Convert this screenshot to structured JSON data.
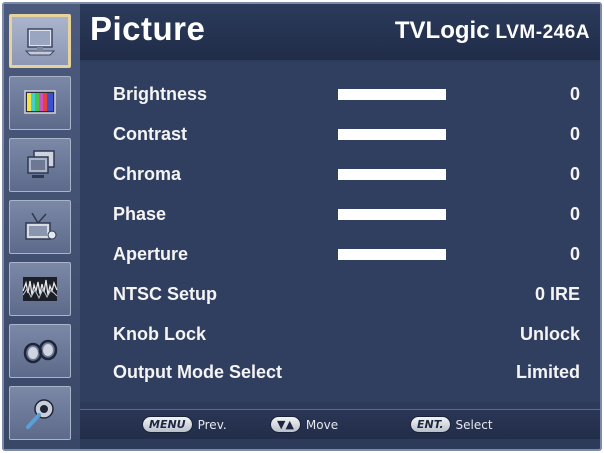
{
  "header": {
    "title": "Picture",
    "brand": "TVLogic",
    "model": "LVM-246A"
  },
  "sidebar": {
    "items": [
      {
        "icon": "monitor-icon",
        "active": true
      },
      {
        "icon": "color-bars-icon",
        "active": false
      },
      {
        "icon": "screens-icon",
        "active": false
      },
      {
        "icon": "satellite-dish-icon",
        "active": false
      },
      {
        "icon": "waveform-icon",
        "active": false
      },
      {
        "icon": "audio-icon",
        "active": false
      },
      {
        "icon": "tools-icon",
        "active": false
      }
    ]
  },
  "menu": {
    "items": [
      {
        "label": "Brightness",
        "value": "0",
        "bar": true
      },
      {
        "label": "Contrast",
        "value": "0",
        "bar": true
      },
      {
        "label": "Chroma",
        "value": "0",
        "bar": true
      },
      {
        "label": "Phase",
        "value": "0",
        "bar": true
      },
      {
        "label": "Aperture",
        "value": "0",
        "bar": true
      },
      {
        "label": "NTSC Setup",
        "value": "0 IRE",
        "bar": false
      },
      {
        "label": "Knob Lock",
        "value": "Unlock",
        "bar": false
      },
      {
        "label": "Output Mode Select",
        "value": "Limited",
        "bar": false
      }
    ]
  },
  "footer": {
    "hints": [
      {
        "key": "MENU",
        "text": "Prev."
      },
      {
        "key": "▼▲",
        "text": "Move"
      },
      {
        "key": "ENT.",
        "text": "Select"
      }
    ]
  },
  "colors": {
    "background": "#2d3a5a",
    "text": "#ffffff",
    "active_border": "#e6d39c"
  }
}
